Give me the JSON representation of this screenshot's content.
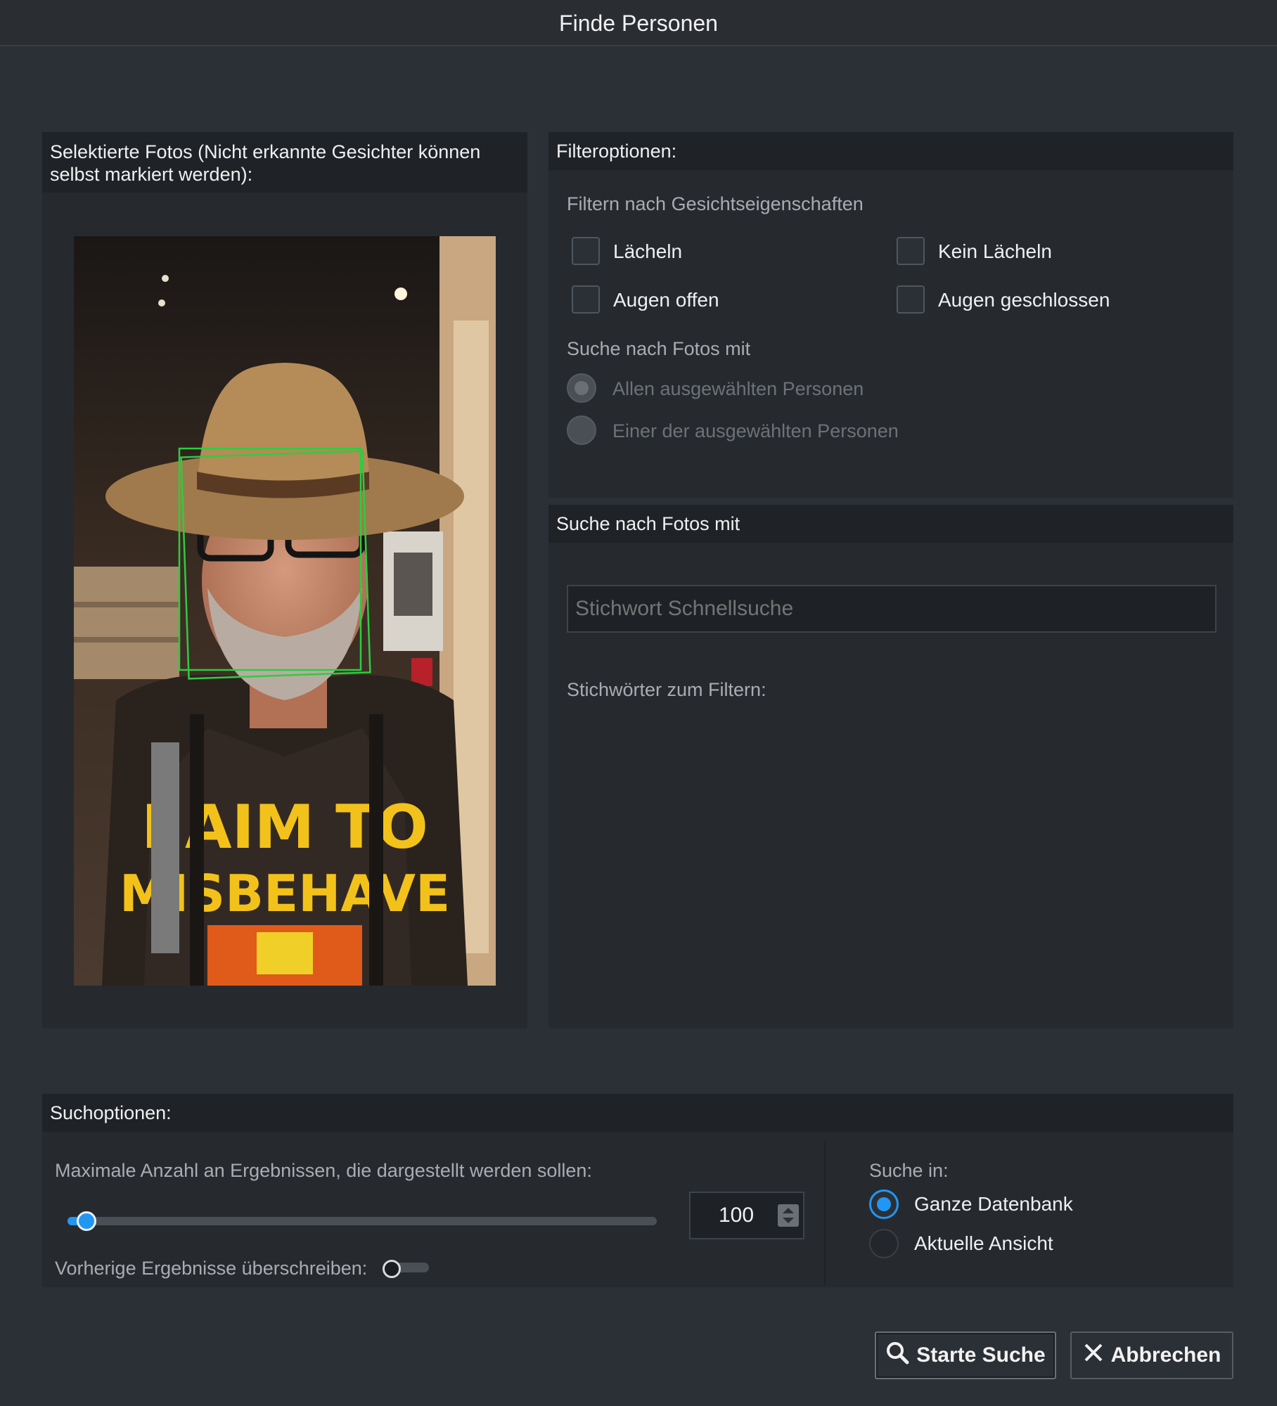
{
  "window": {
    "title": "Finde Personen"
  },
  "photos_panel": {
    "header": "Selektierte Fotos (Nicht erkannte Gesichter können selbst markiert werden):",
    "shirt_line1": "I AIM TO",
    "shirt_line2": "MISBEHAVE"
  },
  "filter_panel": {
    "header": "Filteroptionen:",
    "face_props_label": "Filtern nach Gesichtseigenschaften",
    "checkboxes": [
      {
        "label": "Lächeln",
        "checked": false
      },
      {
        "label": "Kein Lächeln",
        "checked": false
      },
      {
        "label": "Augen offen",
        "checked": false
      },
      {
        "label": "Augen geschlossen",
        "checked": false
      }
    ],
    "search_photos_label": "Suche nach Fotos mit",
    "radios": [
      {
        "label": "Allen ausgewählten Personen",
        "checked": true,
        "disabled": true
      },
      {
        "label": "Einer der ausgewählten Personen",
        "checked": false,
        "disabled": true
      }
    ]
  },
  "keyword_panel": {
    "header": "Suche nach Fotos mit",
    "search_placeholder": "Stichwort Schnellsuche",
    "keywords_label": "Stichwörter zum Filtern:"
  },
  "search_options": {
    "header": "Suchoptionen:",
    "max_results_label": "Maximale Anzahl an Ergebnissen, die dargestellt werden sollen:",
    "max_results_value": "100",
    "slider_fraction": 0.02,
    "overwrite_label": "Vorherige Ergebnisse überschreiben:",
    "overwrite_on": false,
    "search_in_label": "Suche in:",
    "search_in": [
      {
        "label": "Ganze Datenbank",
        "checked": true
      },
      {
        "label": "Aktuelle Ansicht",
        "checked": false
      }
    ]
  },
  "buttons": {
    "start": "Starte Suche",
    "cancel": "Abbrechen"
  },
  "colors": {
    "accent": "#2196f3",
    "face_box": "#2ecc40",
    "background": "#2b3036"
  },
  "icons": {
    "start": "search-icon",
    "cancel": "close-icon"
  }
}
